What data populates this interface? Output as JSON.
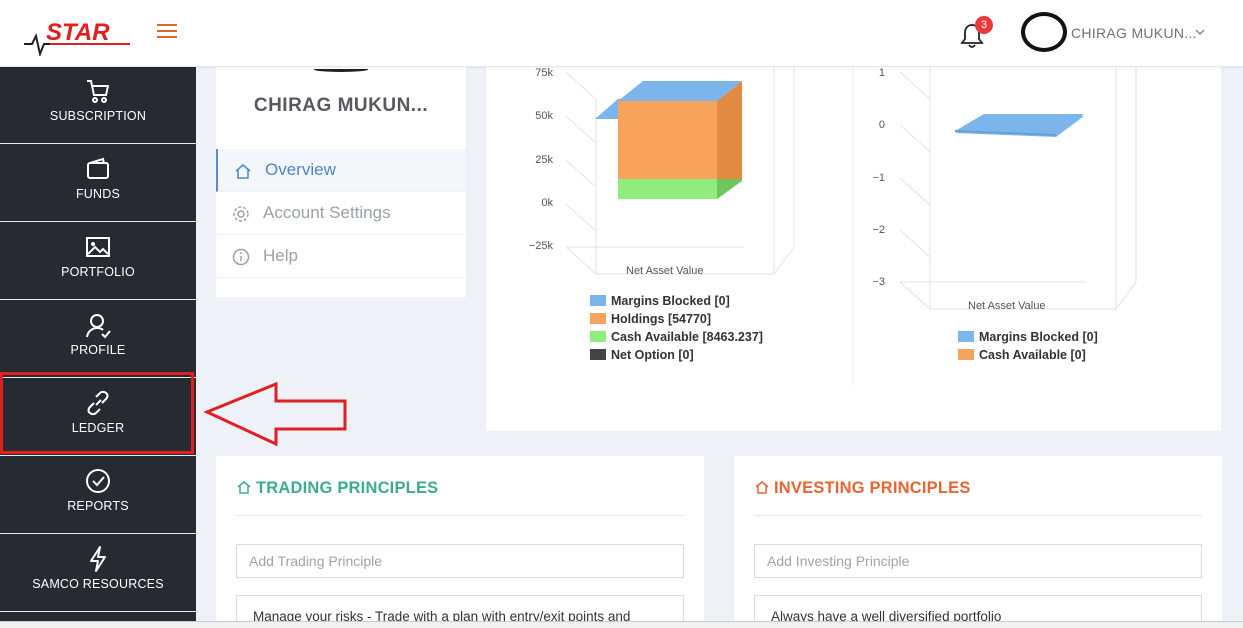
{
  "header": {
    "brand": "STAR",
    "notification_count": "3",
    "user_name": "CHIRAG MUKUN..."
  },
  "sidebar": {
    "items": [
      {
        "label": "SUBSCRIPTION",
        "icon": "cart-icon"
      },
      {
        "label": "FUNDS",
        "icon": "wallet-icon"
      },
      {
        "label": "PORTFOLIO",
        "icon": "image-icon"
      },
      {
        "label": "PROFILE",
        "icon": "user-check-icon"
      },
      {
        "label": "LEDGER",
        "icon": "link-icon"
      },
      {
        "label": "REPORTS",
        "icon": "check-circle-icon"
      },
      {
        "label": "SAMCO RESOURCES",
        "icon": "lightning-icon"
      }
    ],
    "highlight_color": "#e02020"
  },
  "profile": {
    "name": "CHIRAG MUKUN...",
    "menu": [
      {
        "label": "Overview",
        "icon": "home-icon",
        "active": true
      },
      {
        "label": "Account Settings",
        "icon": "gear-icon",
        "active": false
      },
      {
        "label": "Help",
        "icon": "info-icon",
        "active": false
      }
    ]
  },
  "chart_data": [
    {
      "type": "bar",
      "stacked": true,
      "three_d": true,
      "xlabel": "Net Asset Value",
      "y_ticks": [
        "75k",
        "50k",
        "25k",
        "0k",
        "−25k"
      ],
      "ylim": [
        -25000,
        75000
      ],
      "series": [
        {
          "name": "Margins Blocked [0]",
          "value": 0,
          "color": "#7cb5ec"
        },
        {
          "name": "Holdings [54770]",
          "value": 54770,
          "color": "#f7a35c"
        },
        {
          "name": "Cash Available [8463.237]",
          "value": 8463.237,
          "color": "#90ed7d"
        },
        {
          "name": "Net Option [0]",
          "value": 0,
          "color": "#434348"
        }
      ]
    },
    {
      "type": "bar",
      "stacked": true,
      "three_d": true,
      "xlabel": "Net Asset Value",
      "y_ticks": [
        "1",
        "0",
        "−1",
        "−2",
        "−3"
      ],
      "ylim": [
        -3,
        1
      ],
      "series": [
        {
          "name": "Margins Blocked [0]",
          "value": 0,
          "color": "#7cb5ec"
        },
        {
          "name": "Cash Available [0]",
          "value": 0,
          "color": "#f7a35c"
        }
      ]
    }
  ],
  "trading": {
    "title": "TRADING PRINCIPLES",
    "placeholder": "Add Trading Principle",
    "item": "Manage your risks - Trade with a plan with entry/exit points and",
    "color": "#3dab8f"
  },
  "investing": {
    "title": "INVESTING PRINCIPLES",
    "placeholder": "Add Investing Principle",
    "item": "Always have a well diversified portfolio",
    "color": "#e8652f"
  }
}
